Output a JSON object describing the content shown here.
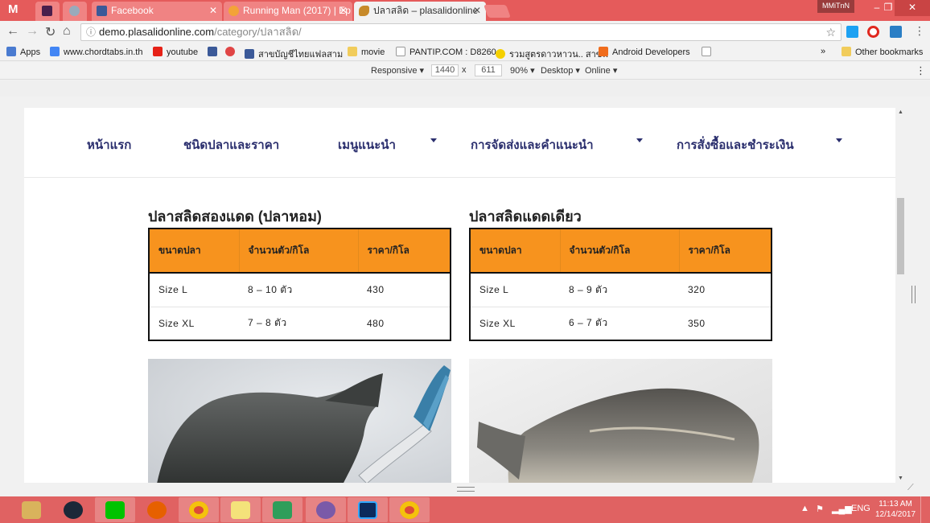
{
  "browser": {
    "tabs": [
      {
        "label": "",
        "kind": "gmail"
      },
      {
        "label": "",
        "kind": "slack"
      },
      {
        "label": "",
        "kind": "check"
      },
      {
        "label": "Facebook",
        "kind": "facebook"
      },
      {
        "label": "Running Man (2017) | Ep",
        "kind": "running"
      },
      {
        "label": "ปลาสลิด – plasalidonline",
        "kind": "fish",
        "active": true
      }
    ],
    "window_user": "MMiTnN",
    "url_host": "demo.plasalidonline.com",
    "url_path": "/category/ปลาสลิด/"
  },
  "bookmarks": [
    {
      "label": "Apps",
      "color": "#4a7bd0"
    },
    {
      "label": "www.chordtabs.in.th",
      "color": "#4285f4"
    },
    {
      "label": "youtube",
      "color": "#e62117"
    },
    {
      "label": "",
      "color": "#3b5998"
    },
    {
      "label": "",
      "color": "#e04545"
    },
    {
      "label": "สาขบัญชีไทยแฟลสาม",
      "color": "#3b5998"
    },
    {
      "label": "movie",
      "color": "#f1cc5b"
    },
    {
      "label": "PANTIP.COM : D8260",
      "color": "#ffffff"
    },
    {
      "label": "รวมสูตรดาวหาวน.. สาขฟ",
      "color": "#f5d000"
    },
    {
      "label": "Android Developers",
      "color": "#f06c1c"
    },
    {
      "label": "",
      "color": "#ffffff"
    }
  ],
  "bookmarks_more": "»",
  "other_bookmarks": "Other bookmarks",
  "device_toolbar": {
    "mode": "Responsive",
    "width": "1440",
    "times": "x",
    "height": "611",
    "zoom": "90%",
    "device": "Desktop",
    "network": "Online"
  },
  "site": {
    "nav": [
      {
        "label": "หน้าแรก",
        "dropdown": false
      },
      {
        "label": "ชนิดปลาและราคา",
        "dropdown": false
      },
      {
        "label": "เมนูแนะนำ",
        "dropdown": true
      },
      {
        "label": "การจัดส่งและคำแนะนำ",
        "dropdown": true
      },
      {
        "label": "การสั่งซื้อและชำระเงิน",
        "dropdown": true
      }
    ],
    "products": [
      {
        "title": "ปลาสลิดสองแดด (ปลาหอม)",
        "headers": [
          "ขนาดปลา",
          "จำนวนตัว/กิโล",
          "ราคา/กิโล"
        ],
        "rows": [
          [
            "Size L",
            "8 – 10 ตัว",
            "430"
          ],
          [
            "Size XL",
            "7 – 8 ตัว",
            "480"
          ]
        ]
      },
      {
        "title": "ปลาสลิดแดดเดียว",
        "headers": [
          "ขนาดปลา",
          "จำนวนตัว/กิโล",
          "ราคา/กิโล"
        ],
        "rows": [
          [
            "Size L",
            "8 – 9 ตัว",
            "320"
          ],
          [
            "Size XL",
            "6 – 7 ตัว",
            "350"
          ]
        ]
      }
    ]
  },
  "taskbar": {
    "apps": [
      {
        "name": "file-explorer",
        "color": "#d9b35c"
      },
      {
        "name": "steam",
        "color": "#1b2838"
      },
      {
        "name": "line",
        "color": "#00c300"
      },
      {
        "name": "firefox",
        "color": "#e66000"
      },
      {
        "name": "chrome",
        "color": "#dd4b39"
      },
      {
        "name": "sticky-notes",
        "color": "#f4e27a"
      },
      {
        "name": "security",
        "color": "#2f9e5a"
      },
      {
        "name": "cat-app",
        "color": "#7a5aa8"
      },
      {
        "name": "photoshop",
        "color": "#0c2a5c"
      },
      {
        "name": "chrome-2",
        "color": "#dd4b39"
      }
    ],
    "lang": "ENG",
    "time": "11:13 AM",
    "date": "12/14/2017"
  }
}
